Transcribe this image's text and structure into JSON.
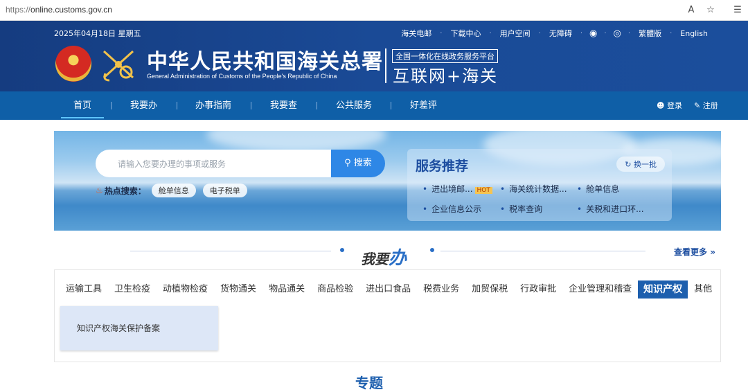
{
  "browser": {
    "url_scheme": "https://",
    "url_host": "online.customs.gov.cn",
    "icons": [
      "read-aloud-icon",
      "favorite-icon",
      "collections-icon"
    ]
  },
  "header": {
    "date": "2025年04月18日 星期五",
    "links": [
      "海关电邮",
      "下载中心",
      "用户空间",
      "无障碍",
      "繁體版",
      "English"
    ],
    "title": "中华人民共和国海关总署",
    "subtitle": "General Administration of Customs of the People's Republic of China",
    "slogan_small": "全国一体化在线政务服务平台",
    "slogan_big": "互联网+海关"
  },
  "nav": {
    "items": [
      "首页",
      "我要办",
      "办事指南",
      "我要查",
      "公共服务",
      "好差评"
    ],
    "login": "登录",
    "register": "注册"
  },
  "banner": {
    "search_placeholder": "请输入您要办理的事项或服务",
    "search_button": "搜索",
    "hot_label": "热点搜索：",
    "hot_tags": [
      "舱单信息",
      "电子税单"
    ],
    "service_title": "服务推荐",
    "refresh_label": "换一批",
    "services": [
      "进出境邮...",
      "海关统计数据...",
      "舱单信息",
      "企业信息公示",
      "税率查询",
      "关税和进口环..."
    ],
    "hot_badge": "HOT"
  },
  "section": {
    "title_a": "我要",
    "title_b": "办",
    "more": "查看更多"
  },
  "tabs": [
    "运输工具",
    "卫生检疫",
    "动植物检疫",
    "货物通关",
    "物品通关",
    "商品检验",
    "进出口食品",
    "税费业务",
    "加贸保税",
    "行政审批",
    "企业管理和稽查",
    "知识产权",
    "其他"
  ],
  "active_tab": "知识产权",
  "card": {
    "label": "知识产权海关保护备案"
  },
  "next_section_partial": "专题",
  "colors": {
    "header_bg": "#1a4a96",
    "nav_bg": "#0f5fa7",
    "accent": "#2e87e6",
    "active_tab": "#1d5fae"
  }
}
